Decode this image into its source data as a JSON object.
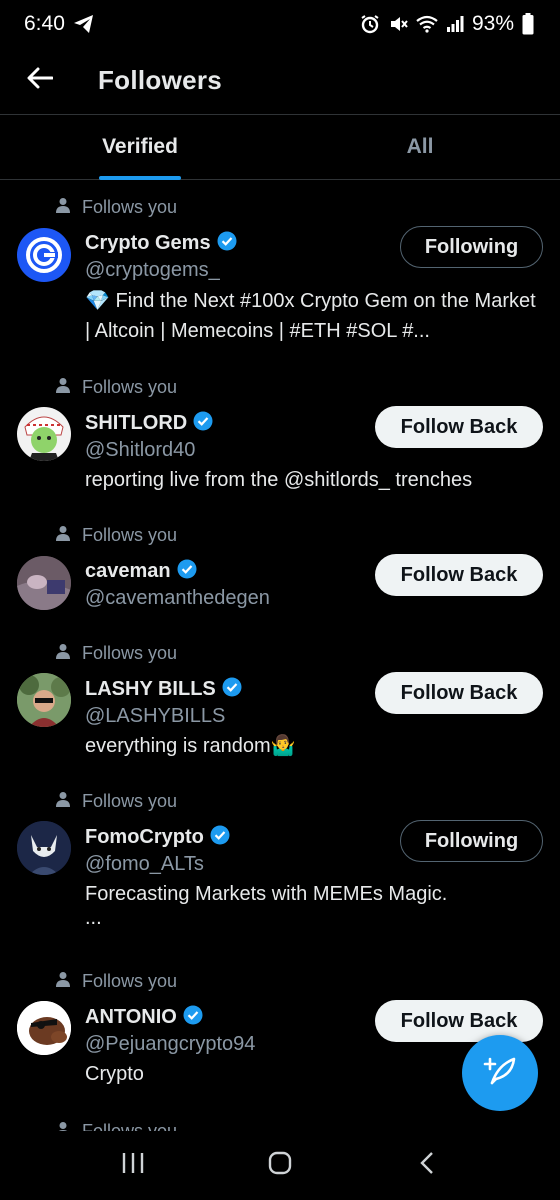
{
  "status_bar": {
    "time": "6:40",
    "battery": "93%",
    "icons": [
      "telegram-icon",
      "alarm-icon",
      "mute-icon",
      "wifi-icon",
      "signal-icon",
      "battery-icon"
    ]
  },
  "header": {
    "title": "Followers",
    "back_icon": "arrow-left-icon"
  },
  "tabs": [
    {
      "label": "Verified",
      "active": true
    },
    {
      "label": "All",
      "active": false
    }
  ],
  "followers": [
    {
      "follows_you": "Follows you",
      "name": "Crypto Gems",
      "handle": "@cryptogems_",
      "bio": "💎 Find the Next #100x Crypto Gem on the Market | Altcoin | Memecoins | #ETH #SOL #...",
      "button": "Following",
      "button_style": "following"
    },
    {
      "follows_you": "Follows you",
      "name": "SHITLORD",
      "handle": "@Shitlord40",
      "bio": "reporting live from the @shitlords_ trenches",
      "button": "Follow Back",
      "button_style": "followback"
    },
    {
      "follows_you": "Follows you",
      "name": "caveman",
      "handle": "@cavemanthedegen",
      "bio": "",
      "button": "Follow Back",
      "button_style": "followback"
    },
    {
      "follows_you": "Follows you",
      "name": "LASHY BILLS",
      "handle": "@LASHYBILLS",
      "bio": "everything is random🤷‍♂️",
      "button": "Follow Back",
      "button_style": "followback"
    },
    {
      "follows_you": "Follows you",
      "name": "FomoCrypto",
      "handle": "@fomo_ALTs",
      "bio": "Forecasting Markets with MEMEs Magic.",
      "bio_more": "...",
      "button": "Following",
      "button_style": "following"
    },
    {
      "follows_you": "Follows you",
      "name": "ANTONIO",
      "handle": "@Pejuangcrypto94",
      "bio": "Crypto",
      "button": "Follow Back",
      "button_style": "followback"
    },
    {
      "follows_you": "Follows you"
    }
  ],
  "colors": {
    "background": "#000000",
    "accent": "#1d9bf0",
    "secondary_text": "#8b98a5",
    "primary_text": "#e7e9ea"
  },
  "fab": {
    "icon": "compose-icon"
  },
  "nav": {
    "icons": [
      "recents-icon",
      "home-icon",
      "back-icon"
    ]
  }
}
